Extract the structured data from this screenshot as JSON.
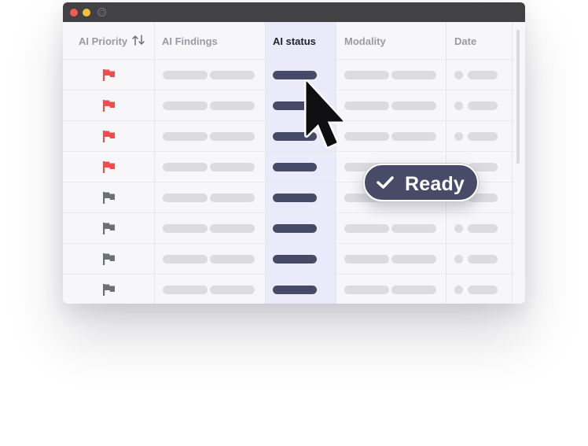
{
  "window": {
    "controls": [
      "close",
      "minimize",
      "zoom"
    ]
  },
  "table": {
    "columns": [
      {
        "label": "AI Priority",
        "sortable": true
      },
      {
        "label": "AI Findings"
      },
      {
        "label": "AI status",
        "active": true
      },
      {
        "label": "Modality"
      },
      {
        "label": "Date"
      }
    ],
    "rows": [
      {
        "priority": "high"
      },
      {
        "priority": "high"
      },
      {
        "priority": "high"
      },
      {
        "priority": "high"
      },
      {
        "priority": "normal"
      },
      {
        "priority": "normal"
      },
      {
        "priority": "normal"
      },
      {
        "priority": "normal"
      }
    ]
  },
  "status_badge": {
    "label": "Ready",
    "icon": "check-icon"
  },
  "colors": {
    "titlebar": "#424244",
    "flag_high": "#ef4d4d",
    "flag_normal": "#6e7078",
    "status_pill": "#464a66",
    "column_highlight": "#ebeafa"
  }
}
